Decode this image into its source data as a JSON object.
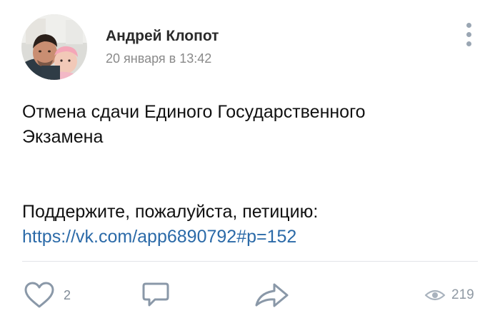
{
  "post": {
    "author": "Андрей Клопот",
    "timestamp": "20 января в 13:42",
    "text_line1": "Отмена сдачи Единого Государственного",
    "text_line2": "Экзамена",
    "text_line3": "Поддержите, пожалуйста, петицию:",
    "link": "https://vk.com/app6890792#p=152"
  },
  "actions": {
    "likes": "2",
    "views": "219"
  },
  "icons": {
    "more": "more-vertical-icon",
    "like": "heart-icon",
    "comment": "comment-icon",
    "share": "share-arrow-icon",
    "views": "eye-icon"
  },
  "colors": {
    "link": "#2b6aa8",
    "icon": "#8a98a8",
    "muted": "#8a8a8a"
  }
}
